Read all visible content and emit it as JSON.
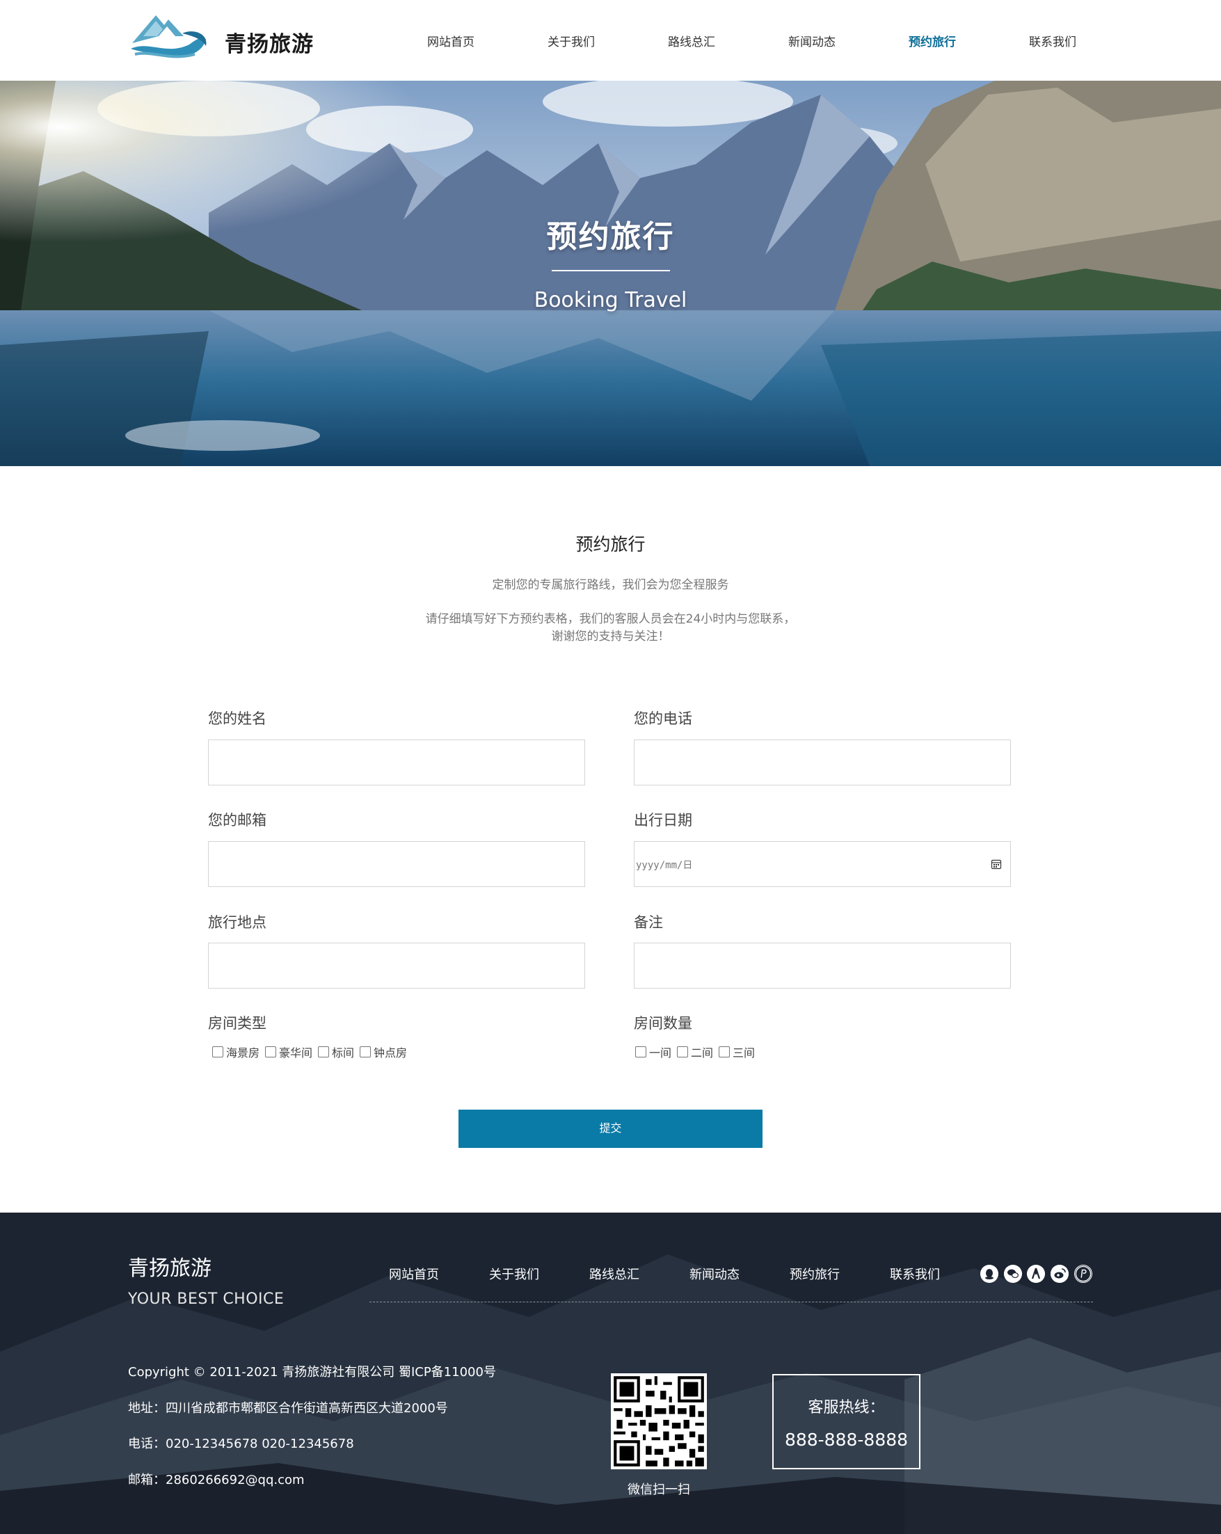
{
  "header": {
    "brand": "青扬旅游",
    "nav": [
      "网站首页",
      "关于我们",
      "路线总汇",
      "新闻动态",
      "预约旅行",
      "联系我们"
    ],
    "active_index": 4
  },
  "banner": {
    "title": "预约旅行",
    "subtitle": "Booking Travel"
  },
  "intro": {
    "title": "预约旅行",
    "subtitle": "定制您的专属旅行路线，我们会为您全程服务",
    "desc_line1": "请仔细填写好下方预约表格，我们的客服人员会在24小时内与您联系，",
    "desc_line2": "谢谢您的支持与关注！"
  },
  "form": {
    "name_label": "您的姓名",
    "phone_label": "您的电话",
    "email_label": "您的邮箱",
    "date_label": "出行日期",
    "date_placeholder": "yyyy/mm/日",
    "place_label": "旅行地点",
    "note_label": "备注",
    "room_type_label": "房间类型",
    "room_types": [
      "海景房",
      "豪华间",
      "标间",
      "钟点房"
    ],
    "room_count_label": "房间数量",
    "room_counts": [
      "一间",
      "二间",
      "三间"
    ],
    "submit_label": "提交"
  },
  "footer": {
    "brand": "青扬旅游",
    "slogan": "YOUR BEST CHOICE",
    "nav": [
      "网站首页",
      "关于我们",
      "路线总汇",
      "新闻动态",
      "预约旅行",
      "联系我们"
    ],
    "social_icons": [
      "qq-icon",
      "wechat-icon",
      "renren-icon",
      "weibo-icon",
      "paypal-icon"
    ],
    "copyright": "Copyright © 2011-2021 青扬旅游社有限公司 蜀ICP备11000号",
    "address": "地址：四川省成都市郫都区合作街道高新西区大道2000号",
    "phone": "电话：020-12345678 020-12345678",
    "email": "邮箱：2860266692@qq.com",
    "qr_caption": "微信扫一扫",
    "hotline_label": "客服热线：",
    "hotline_number": "888-888-8888"
  },
  "colors": {
    "accent": "#0a7aa6",
    "nav_active": "#0e6f98",
    "footer_bg": "#1c2431"
  }
}
